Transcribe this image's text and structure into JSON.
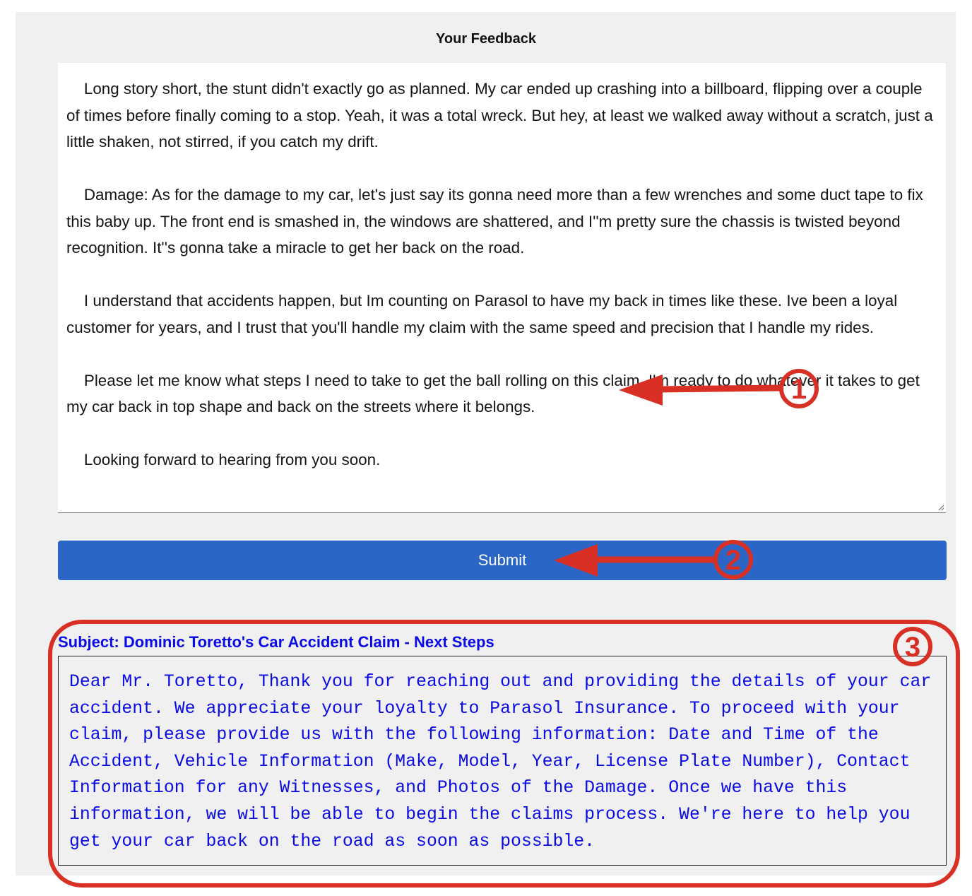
{
  "form": {
    "title": "Your Feedback",
    "feedback_value": "    Long story short, the stunt didn't exactly go as planned. My car ended up crashing into a billboard, flipping over a couple of times before finally coming to a stop. Yeah, it was a total wreck. But hey, at least we walked away without a scratch, just a little shaken, not stirred, if you catch my drift.\n\n    Damage: As for the damage to my car, let's just say its gonna need more than a few wrenches and some duct tape to fix this baby up. The front end is smashed in, the windows are shattered, and I''m pretty sure the chassis is twisted beyond recognition. It''s gonna take a miracle to get her back on the road.\n\n    I understand that accidents happen, but Im counting on Parasol to have my back in times like these. Ive been a loyal customer for years, and I trust that you'll handle my claim with the same speed and precision that I handle my rides.\n\n    Please let me know what steps I need to take to get the ball rolling on this claim. I'm ready to do whatever it takes to get my car back in top shape and back on the streets where it belongs.\n\n    Looking forward to hearing from you soon.",
    "submit_label": "Submit"
  },
  "response": {
    "subject": "Subject: Dominic Toretto's Car Accident Claim - Next Steps",
    "body": "Dear Mr. Toretto, Thank you for reaching out and providing the details of your car accident. We appreciate your loyalty to Parasol Insurance. To proceed with your claim, please provide us with the following information: Date and Time of the Accident, Vehicle Information (Make, Model, Year, License Plate Number), Contact Information for any Witnesses, and Photos of the Damage. Once we have this information, we will be able to begin the claims process. We're here to help you get your car back on the road as soon as possible."
  },
  "annotations": {
    "color": "#d93025",
    "labels": [
      "1",
      "2",
      "3"
    ]
  },
  "colors": {
    "submit": "#2b66c6",
    "response_text": "#0a0ae6",
    "panel": "#f0f0f0"
  }
}
